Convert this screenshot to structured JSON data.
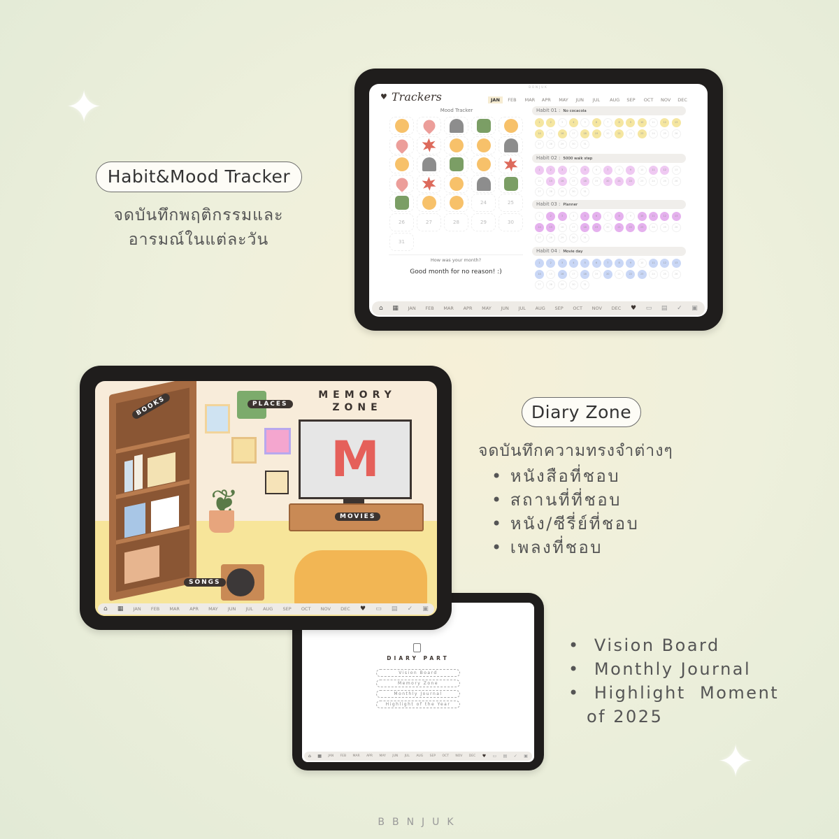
{
  "colors": {
    "accent_dark": "#3c3430",
    "habit1": "#f5e6a0",
    "habit2": "#efc9f2",
    "habit3": "#e5b1ee",
    "habit4": "#c9d7f6"
  },
  "section1": {
    "pill": "Habit&Mood Tracker",
    "desc": [
      "จดบันทึกพฤติกรรมและ",
      "อารมณ์ในแต่ละวัน"
    ]
  },
  "section2": {
    "pill": "Diary Zone",
    "desc": "จดบันทึกความทรงจำต่างๆ",
    "bullets": [
      "หนังสือที่ชอบ",
      "สถานที่ที่ชอบ",
      "หนัง/ซีรี่ย์ที่ชอบ",
      "เพลงที่ชอบ"
    ]
  },
  "section3": {
    "bullets": [
      "Vision Board",
      "Monthly Journal",
      "Highlight  Moment",
      "of 2025"
    ]
  },
  "brand": "BBNJUK",
  "months": [
    "JAN",
    "FEB",
    "MAR",
    "APR",
    "MAY",
    "JUN",
    "JUL",
    "AUG",
    "SEP",
    "OCT",
    "NOV",
    "DEC"
  ],
  "tracker": {
    "screen_brand": "BONJUK",
    "title": "Trackers",
    "selected_month": "JAN",
    "mood_title": "Mood Tracker",
    "moods": [
      "sun",
      "heart",
      "ghost",
      "green",
      "sun",
      "heart",
      "star",
      "sun",
      "sun",
      "ghost",
      "sun",
      "ghost",
      "green",
      "sun",
      "star",
      "heart",
      "star",
      "sun",
      "ghost",
      "green",
      "green",
      "sun",
      "sun"
    ],
    "days_in_month": 31,
    "question": "How was your month?",
    "answer": "Good month for no reason!  :)",
    "habits": [
      {
        "label": "Habit 01 :",
        "name": "No cocacola",
        "done": [
          1,
          2,
          4,
          6,
          8,
          9,
          10,
          12,
          13,
          14,
          16,
          18,
          19,
          21,
          23
        ]
      },
      {
        "label": "Habit 02 :",
        "name": "5000 walk step",
        "done": [
          1,
          2,
          3,
          5,
          7,
          9,
          11,
          12,
          15,
          16,
          18,
          20,
          21,
          22
        ]
      },
      {
        "label": "Habit 03 :",
        "name": "Planner",
        "done": [
          2,
          3,
          5,
          6,
          8,
          10,
          11,
          12,
          13,
          14,
          15,
          18,
          19,
          21,
          22,
          23
        ]
      },
      {
        "label": "Habit 04 :",
        "name": "Movie day",
        "done": [
          1,
          2,
          3,
          4,
          5,
          6,
          7,
          8,
          9,
          11,
          12,
          13,
          14,
          16,
          18,
          20,
          22,
          23
        ]
      }
    ]
  },
  "memory": {
    "title1": "MEMORY",
    "title2": "ZONE",
    "books": "BOOKS",
    "places": "PLACES",
    "movies": "MOVIES",
    "songs": "SONGS",
    "tv_letter": "M"
  },
  "diary": {
    "title": "DIARY PART",
    "buttons": [
      "Vision Board",
      "Memory Zone",
      "Monthly Journal",
      "Highlight of the Year"
    ]
  }
}
